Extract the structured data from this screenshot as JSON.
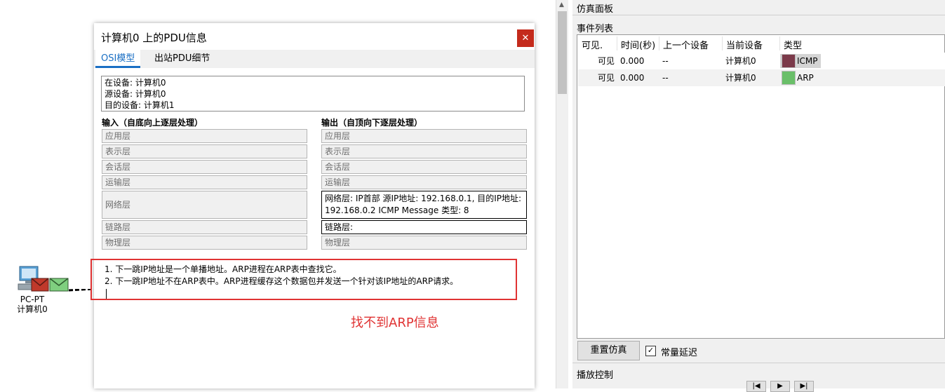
{
  "workspace": {
    "device": {
      "model": "PC-PT",
      "name": "计算机0"
    }
  },
  "dialog": {
    "title": "计算机0 上的PDU信息",
    "close_glyph": "✕",
    "tabs": [
      {
        "label": "OSI模型"
      },
      {
        "label": "出站PDU细节"
      }
    ],
    "device_info": [
      "在设备: 计算机0",
      "源设备: 计算机0",
      "目的设备: 计算机1"
    ],
    "in_header": "输入（自底向上逐层处理）",
    "out_header": "输出（自顶向下逐层处理）",
    "in_layers": [
      "应用层",
      "表示层",
      "会话层",
      "运输层",
      "网络层",
      "链路层",
      "物理层"
    ],
    "out_layers": [
      "应用层",
      "表示层",
      "会话层",
      "运输层",
      "网络层: IP首部 源IP地址: 192.168.0.1, 目的IP地址: 192.168.0.2 ICMP Message 类型: 8",
      "链路层:",
      "物理层"
    ],
    "notes": [
      "1. 下一跳IP地址是一个单播地址。ARP进程在ARP表中查找它。",
      "2. 下一跳IP地址不在ARP表中。ARP进程缓存这个数据包并发送一个针对该IP地址的ARP请求。"
    ]
  },
  "annotation": "找不到ARP信息",
  "sim_panel": {
    "title": "仿真面板",
    "event_list_label": "事件列表",
    "columns": [
      "可见.",
      "时间(秒)",
      "上一个设备",
      "当前设备",
      "类型"
    ],
    "events": [
      {
        "visible": "可见",
        "time": "0.000",
        "last": "--",
        "current": "计算机0",
        "type": "ICMP",
        "color": "#7b3a4a"
      },
      {
        "visible": "可见",
        "time": "0.000",
        "last": "--",
        "current": "计算机0",
        "type": "ARP",
        "color": "#6abf69"
      }
    ],
    "reset_label": "重置仿真",
    "constant_delay_label": "常量延迟",
    "constant_delay_checked": "✓",
    "playback_label": "播放控制"
  }
}
